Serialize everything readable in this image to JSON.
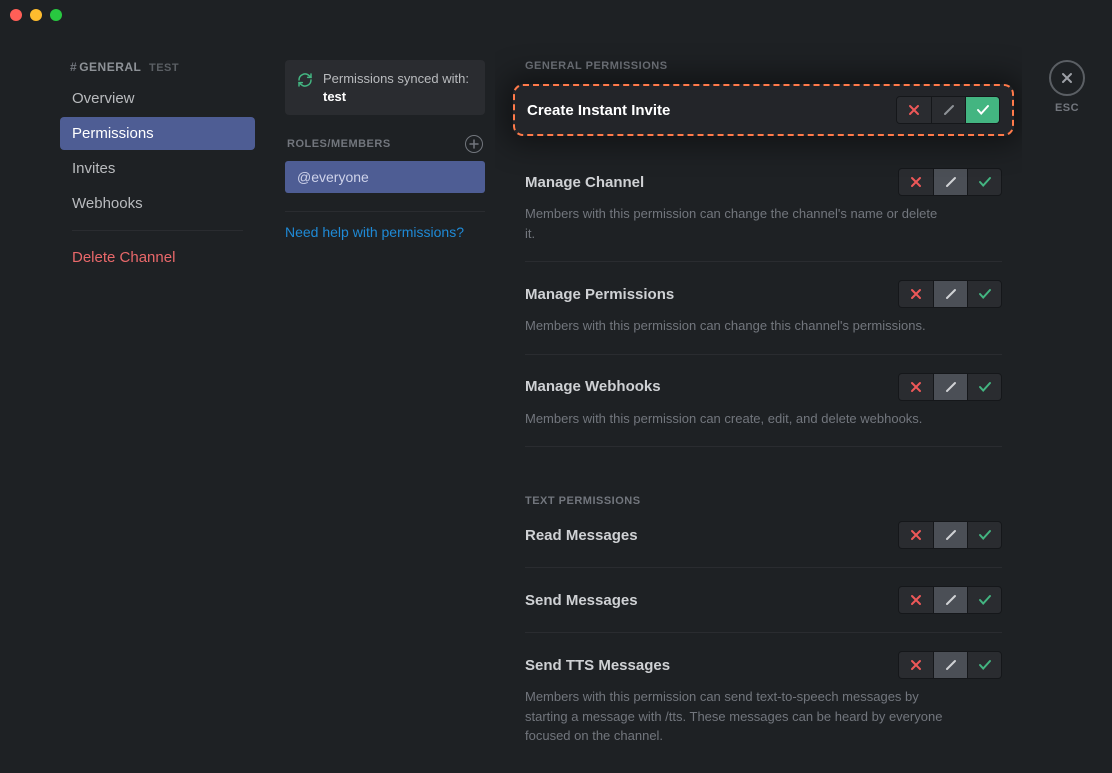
{
  "sidebar": {
    "channel_hash": "#",
    "channel_name": "GENERAL",
    "channel_tag": "TEST",
    "items": {
      "overview": "Overview",
      "permissions": "Permissions",
      "invites": "Invites",
      "webhooks": "Webhooks",
      "delete": "Delete Channel"
    }
  },
  "mid": {
    "sync_label": "Permissions synced with:",
    "sync_server": "test",
    "roles_header": "ROLES/MEMBERS",
    "role_everyone": "@everyone",
    "help_link": "Need help with permissions?"
  },
  "esc_label": "ESC",
  "sections": {
    "general": "GENERAL PERMISSIONS",
    "text": "TEXT PERMISSIONS"
  },
  "permissions": {
    "create_invite": {
      "title": "Create Instant Invite"
    },
    "manage_channel": {
      "title": "Manage Channel",
      "desc": "Members with this permission can change the channel's name or delete it."
    },
    "manage_permissions": {
      "title": "Manage Permissions",
      "desc": "Members with this permission can change this channel's permissions."
    },
    "manage_webhooks": {
      "title": "Manage Webhooks",
      "desc": "Members with this permission can create, edit, and delete webhooks."
    },
    "read_messages": {
      "title": "Read Messages"
    },
    "send_messages": {
      "title": "Send Messages"
    },
    "send_tts": {
      "title": "Send TTS Messages",
      "desc": "Members with this permission can send text-to-speech messages by starting a message with /tts. These messages can be heard by everyone focused on the channel."
    }
  }
}
